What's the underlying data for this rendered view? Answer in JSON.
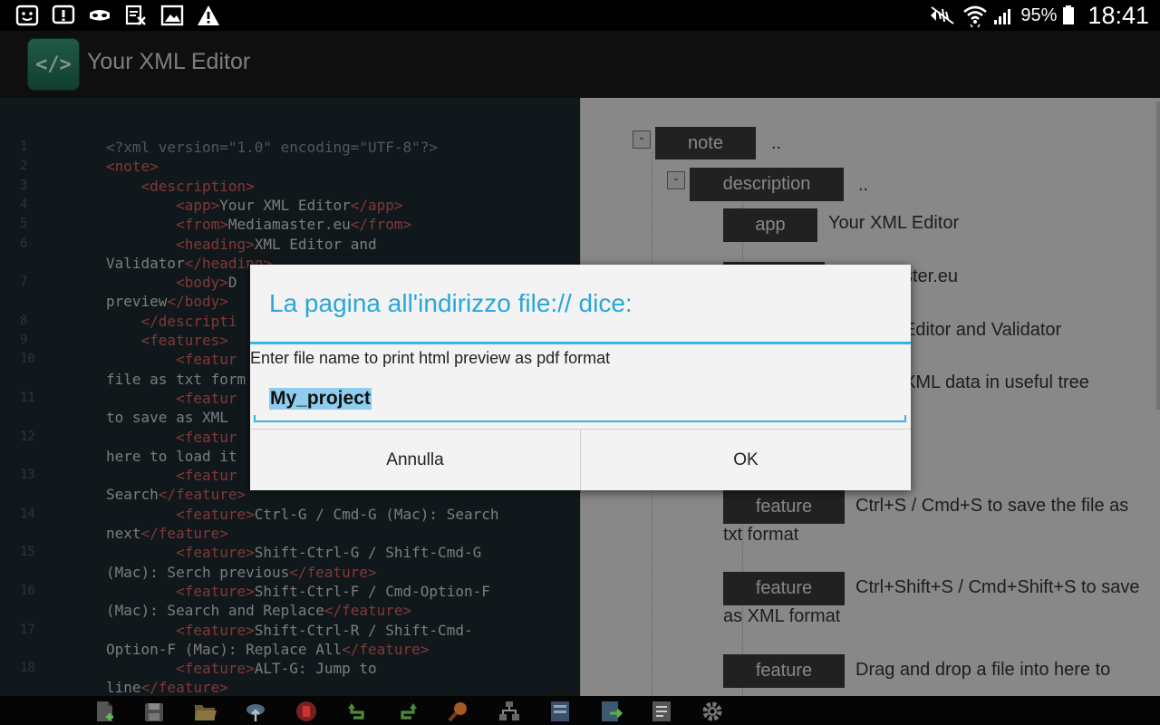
{
  "statusbar": {
    "left_icons": [
      "face-notification-icon",
      "alert-box-icon",
      "spy-mask-icon",
      "file-x-icon",
      "image-icon",
      "warning-icon"
    ],
    "right_icons": [
      "mute-icon",
      "wifi-icon",
      "signal-icon",
      "battery-icon"
    ],
    "battery": "95%",
    "time": "18:41"
  },
  "actionbar": {
    "logo": "</>",
    "title": "Your XML Editor"
  },
  "editor": {
    "lines": [
      {
        "n": "1",
        "segments": [
          [
            "decl",
            "<?xml version=\"1.0\" encoding=\"UTF-8\"?>"
          ]
        ]
      },
      {
        "n": "2",
        "segments": [
          [
            "tag",
            "<note>"
          ]
        ]
      },
      {
        "n": "3",
        "segments": [
          [
            "txt",
            "    "
          ],
          [
            "tag",
            "<description>"
          ]
        ]
      },
      {
        "n": "4",
        "segments": [
          [
            "txt",
            "        "
          ],
          [
            "tag",
            "<app>"
          ],
          [
            "txt",
            "Your XML Editor"
          ],
          [
            "tag",
            "</app>"
          ]
        ]
      },
      {
        "n": "5",
        "segments": [
          [
            "txt",
            "        "
          ],
          [
            "tag",
            "<from>"
          ],
          [
            "txt",
            "Mediamaster.eu"
          ],
          [
            "tag",
            "</from>"
          ]
        ]
      },
      {
        "n": "6",
        "segments": [
          [
            "txt",
            "        "
          ],
          [
            "tag",
            "<heading>"
          ],
          [
            "txt",
            "XML Editor and"
          ]
        ]
      },
      {
        "n": "",
        "segments": [
          [
            "txt",
            "Validator"
          ],
          [
            "tag",
            "</heading>"
          ]
        ]
      },
      {
        "n": "7",
        "segments": [
          [
            "txt",
            "        "
          ],
          [
            "tag",
            "<body>"
          ],
          [
            "txt",
            "D"
          ]
        ]
      },
      {
        "n": "",
        "segments": [
          [
            "txt",
            "preview"
          ],
          [
            "tag",
            "</body>"
          ]
        ]
      },
      {
        "n": "8",
        "segments": [
          [
            "txt",
            "    "
          ],
          [
            "tag",
            "</descripti"
          ]
        ]
      },
      {
        "n": "9",
        "segments": [
          [
            "txt",
            "    "
          ],
          [
            "tag",
            "<features>"
          ]
        ]
      },
      {
        "n": "10",
        "segments": [
          [
            "txt",
            "        "
          ],
          [
            "tag",
            "<featur"
          ]
        ]
      },
      {
        "n": "",
        "segments": [
          [
            "txt",
            "file as txt form"
          ]
        ]
      },
      {
        "n": "11",
        "segments": [
          [
            "txt",
            "        "
          ],
          [
            "tag",
            "<featur"
          ]
        ]
      },
      {
        "n": "",
        "segments": [
          [
            "txt",
            "to save as XML"
          ]
        ]
      },
      {
        "n": "12",
        "segments": [
          [
            "txt",
            "        "
          ],
          [
            "tag",
            "<featur"
          ]
        ]
      },
      {
        "n": "",
        "segments": [
          [
            "txt",
            "here to load it"
          ]
        ]
      },
      {
        "n": "13",
        "segments": [
          [
            "txt",
            "        "
          ],
          [
            "tag",
            "<featur"
          ]
        ]
      },
      {
        "n": "",
        "segments": [
          [
            "txt",
            "Search"
          ],
          [
            "tag",
            "</feature>"
          ]
        ]
      },
      {
        "n": "14",
        "segments": [
          [
            "txt",
            "        "
          ],
          [
            "tag",
            "<feature>"
          ],
          [
            "txt",
            "Ctrl-G / Cmd-G (Mac): Search"
          ]
        ]
      },
      {
        "n": "",
        "segments": [
          [
            "txt",
            "next"
          ],
          [
            "tag",
            "</feature>"
          ]
        ]
      },
      {
        "n": "15",
        "segments": [
          [
            "txt",
            "        "
          ],
          [
            "tag",
            "<feature>"
          ],
          [
            "txt",
            "Shift-Ctrl-G / Shift-Cmd-G"
          ]
        ]
      },
      {
        "n": "",
        "segments": [
          [
            "txt",
            "(Mac): Serch previous"
          ],
          [
            "tag",
            "</feature>"
          ]
        ]
      },
      {
        "n": "16",
        "segments": [
          [
            "txt",
            "        "
          ],
          [
            "tag",
            "<feature>"
          ],
          [
            "txt",
            "Shift-Ctrl-F / Cmd-Option-F"
          ]
        ]
      },
      {
        "n": "",
        "segments": [
          [
            "txt",
            "(Mac): Search and Replace"
          ],
          [
            "tag",
            "</feature>"
          ]
        ]
      },
      {
        "n": "17",
        "segments": [
          [
            "txt",
            "        "
          ],
          [
            "tag",
            "<feature>"
          ],
          [
            "txt",
            "Shift-Ctrl-R / Shift-Cmd-"
          ]
        ]
      },
      {
        "n": "",
        "segments": [
          [
            "txt",
            "Option-F (Mac): Replace All"
          ],
          [
            "tag",
            "</feature>"
          ]
        ]
      },
      {
        "n": "18",
        "segments": [
          [
            "txt",
            "        "
          ],
          [
            "tag",
            "<feature>"
          ],
          [
            "txt",
            "ALT-G: Jump to"
          ]
        ]
      },
      {
        "n": "",
        "segments": [
          [
            "txt",
            "line"
          ],
          [
            "tag",
            "</feature>"
          ]
        ]
      }
    ]
  },
  "tree": {
    "note_label": "note",
    "note_value": "..",
    "description_label": "description",
    "description_value": "..",
    "toggle_symbol": "-",
    "app_label": "app",
    "app_value": "Your XML Editor",
    "from_value": "ster.eu",
    "heading_value": "Editor and Validator",
    "body_value": "XML data in useful tree",
    "features": [
      {
        "label": "feature",
        "value": "Ctrl+S / Cmd+S to save the file as txt format"
      },
      {
        "label": "feature",
        "value": "Ctrl+Shift+S / Cmd+Shift+S to save as XML format"
      },
      {
        "label": "feature",
        "value": "Drag and drop a file into here to"
      }
    ]
  },
  "dialog": {
    "title": "La pagina all'indirizzo file:// dice:",
    "message": "Enter file name to print html preview as pdf format",
    "input_value": "My_project",
    "cancel_label": "Annulla",
    "ok_label": "OK"
  },
  "toolbar": {
    "icons": [
      "new-file-icon",
      "save-icon",
      "open-folder-icon",
      "cloud-upload-icon",
      "pdf-icon",
      "undo-icon",
      "redo-icon",
      "search-icon",
      "tree-view-icon",
      "html-preview-icon",
      "export-icon",
      "notes-icon",
      "settings-icon"
    ]
  },
  "colors": {
    "accent": "#33b5e5",
    "editor_bg": "#1e2a31",
    "tag": "#e06060",
    "tree_bg": "#ebebeb",
    "node_box": "#3a3a3a"
  }
}
